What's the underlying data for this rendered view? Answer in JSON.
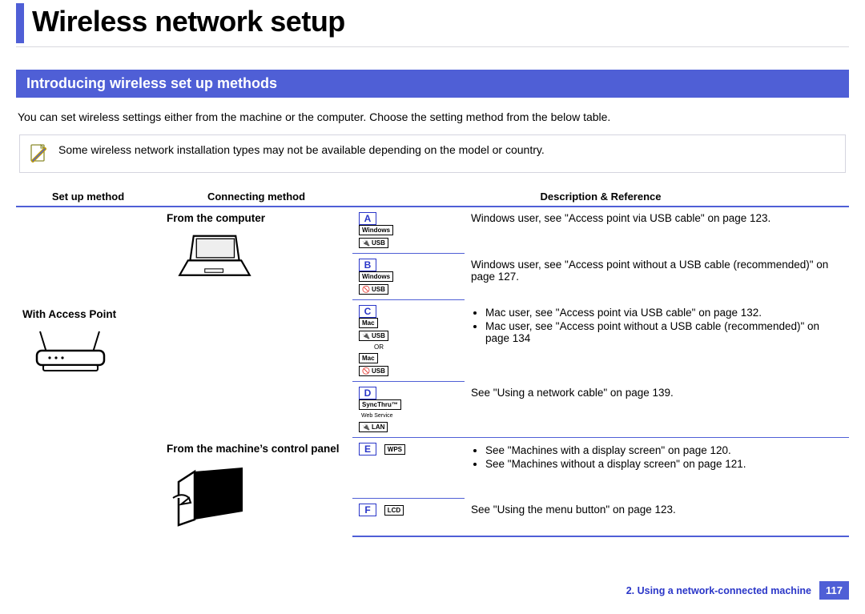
{
  "title": "Wireless network setup",
  "section": "Introducing wireless set up methods",
  "intro": "You can set wireless settings either from the machine or the computer. Choose the setting method from the below table.",
  "note": "Some wireless network installation types may not be available depending on the model or country.",
  "table": {
    "headers": {
      "setup": "Set up method",
      "connect": "Connecting method",
      "desc": "Description & Reference"
    },
    "setup_method": "With Access Point",
    "connect_methods": {
      "from_computer": "From the computer",
      "from_panel": "From the machine’s control panel"
    },
    "chips": {
      "a": "A",
      "b": "B",
      "c": "C",
      "d": "D",
      "e": "E",
      "f": "F"
    },
    "chip_labels": {
      "a_os": "Windows",
      "a_conn": "USB",
      "b_os": "Windows",
      "b_conn": "USB",
      "c_os": "Mac",
      "c_conn_usb": "USB",
      "c_or": "OR",
      "c_conn_nousb": "USB",
      "d_app": "SyncThru™",
      "d_sub": "Web Service",
      "d_conn": "LAN",
      "e_label": "WPS",
      "f_label": "LCD"
    },
    "rows": {
      "a": "Windows user, see \"Access point via USB cable\" on page 123.",
      "b": "Windows user, see \"Access point without a USB cable (recommended)\" on page 127.",
      "c": [
        "Mac user, see \"Access point via USB cable\" on page 132.",
        "Mac user, see \"Access point without a USB cable (recommended)\" on page 134"
      ],
      "d": "See \"Using a network cable\" on page 139.",
      "e": [
        "See \"Machines with a display screen\" on page 120.",
        "See \"Machines without a display screen\" on page 121."
      ],
      "f": "See \"Using the menu button\" on page 123."
    }
  },
  "footer": {
    "chapter": "2.  Using a network-connected machine",
    "page": "117"
  }
}
